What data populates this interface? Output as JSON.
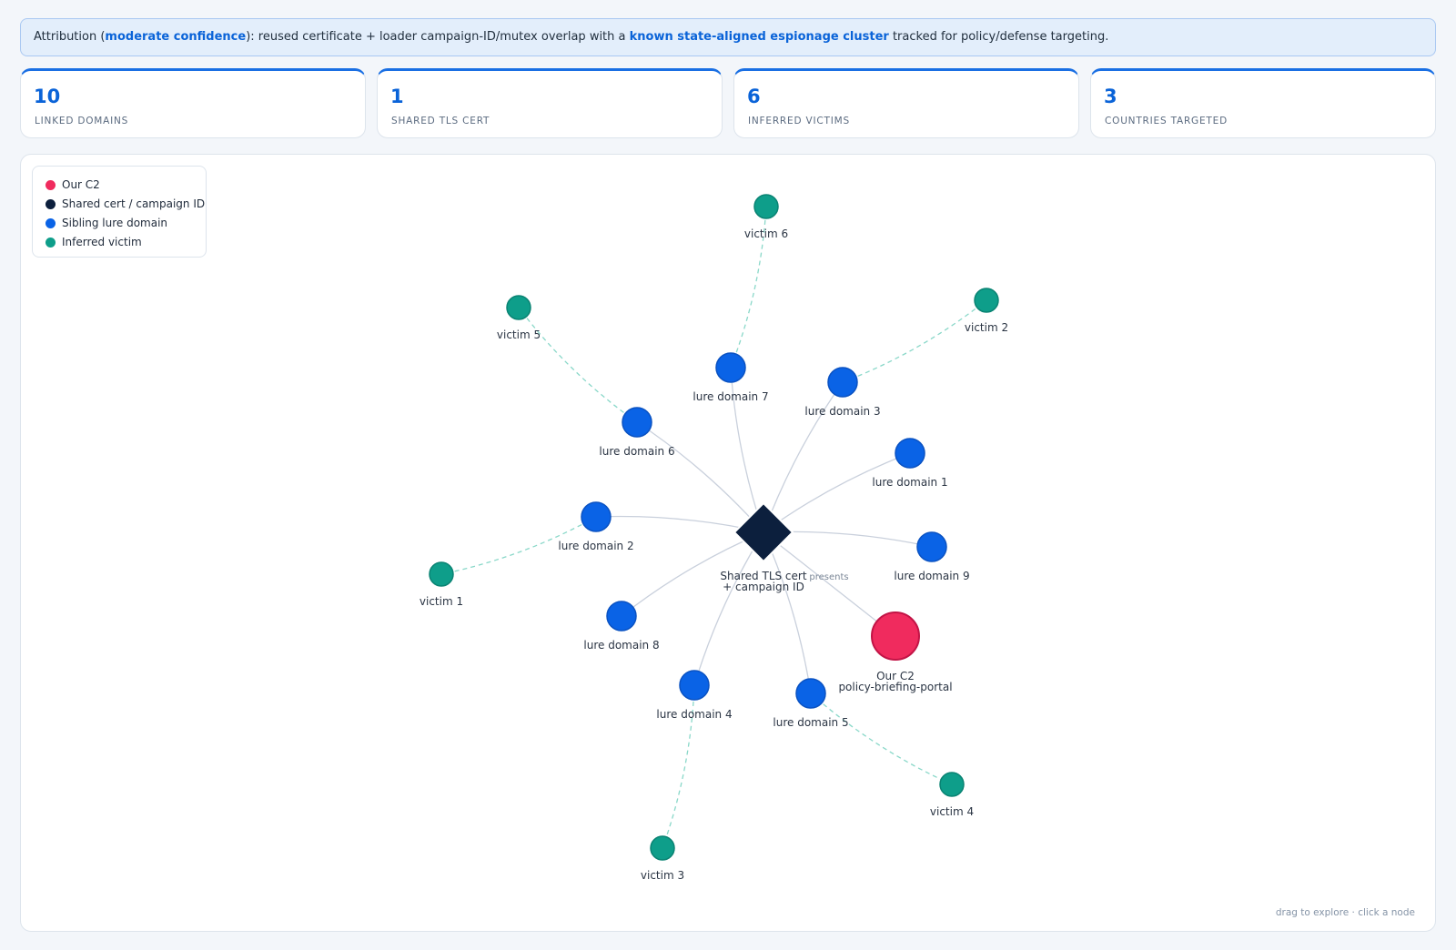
{
  "banner": {
    "prefix": "Attribution (",
    "confidence": "moderate confidence",
    "middle": "): reused certificate + loader campaign-ID/mutex overlap with a ",
    "cluster": "known state-aligned espionage cluster",
    "suffix": " tracked for policy/defense targeting."
  },
  "stats": [
    {
      "value": "10",
      "label": "LINKED DOMAINS"
    },
    {
      "value": "1",
      "label": "SHARED TLS CERT"
    },
    {
      "value": "6",
      "label": "INFERRED VICTIMS"
    },
    {
      "value": "3",
      "label": "COUNTRIES TARGETED"
    }
  ],
  "legend": {
    "items": [
      {
        "label": "Our C2",
        "color": "#f02b5e"
      },
      {
        "label": "Shared cert / campaign ID",
        "color": "#0c1f3d"
      },
      {
        "label": "Sibling lure domain",
        "color": "#0a63e6"
      },
      {
        "label": "Inferred victim",
        "color": "#0e9e8a"
      }
    ]
  },
  "graph": {
    "hub": {
      "label_line1": "Shared TLS cert",
      "label_line2": "+ campaign ID",
      "color": "#0c1f3d"
    },
    "c2": {
      "label_line1": "Our C2",
      "label_line2": "policy-briefing-portal",
      "edge_label": "presents",
      "color": "#f02b5e"
    },
    "lure_color": "#0a63e6",
    "victim_color": "#0e9e8a",
    "lures": [
      {
        "id": "l1",
        "label": "lure domain 1"
      },
      {
        "id": "l2",
        "label": "lure domain 2"
      },
      {
        "id": "l3",
        "label": "lure domain 3"
      },
      {
        "id": "l4",
        "label": "lure domain 4"
      },
      {
        "id": "l5",
        "label": "lure domain 5"
      },
      {
        "id": "l6",
        "label": "lure domain 6"
      },
      {
        "id": "l7",
        "label": "lure domain 7"
      },
      {
        "id": "l8",
        "label": "lure domain 8"
      },
      {
        "id": "l9",
        "label": "lure domain 9"
      }
    ],
    "victims": [
      {
        "id": "v1",
        "label": "victim 1",
        "lure": "l2"
      },
      {
        "id": "v2",
        "label": "victim 2",
        "lure": "l3"
      },
      {
        "id": "v3",
        "label": "victim 3",
        "lure": "l4"
      },
      {
        "id": "v4",
        "label": "victim 4",
        "lure": "l5"
      },
      {
        "id": "v5",
        "label": "victim 5",
        "lure": "l6"
      },
      {
        "id": "v6",
        "label": "victim 6",
        "lure": "l7"
      }
    ]
  },
  "hint": "drag to explore · click a node"
}
